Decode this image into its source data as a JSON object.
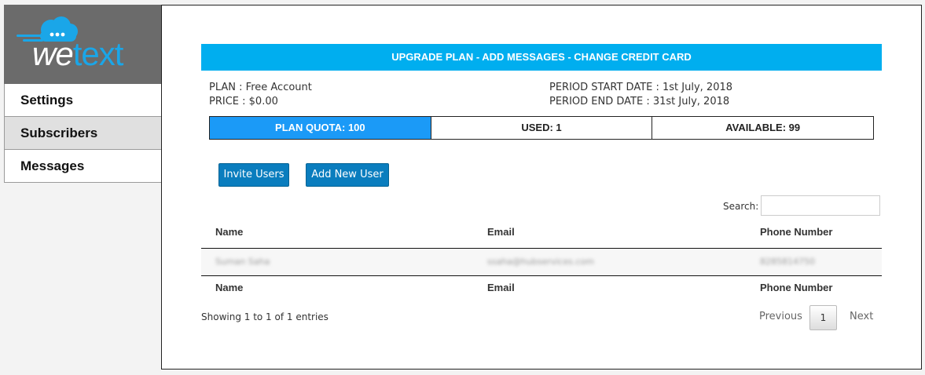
{
  "logo": {
    "text": "wetext"
  },
  "sidebar": {
    "items": [
      {
        "label": "Settings"
      },
      {
        "label": "Subscribers"
      },
      {
        "label": "Messages"
      }
    ]
  },
  "upgrade_bar": {
    "label": "UPGRADE PLAN - ADD MESSAGES - CHANGE CREDIT CARD"
  },
  "plan": {
    "plan_label": "PLAN :",
    "plan_value": "Free Account",
    "price_label": "PRICE :",
    "price_value": "$0.00",
    "start_label": "PERIOD START DATE :",
    "start_value": "1st July, 2018",
    "end_label": "PERIOD END DATE :",
    "end_value": "31st July, 2018"
  },
  "quota": {
    "plan_quota": "PLAN QUOTA: 100",
    "used": "USED: 1",
    "available": "AVAILABLE: 99"
  },
  "buttons": {
    "invite": "Invite Users",
    "add_new": "Add New User"
  },
  "search": {
    "label": "Search:",
    "value": ""
  },
  "table": {
    "columns": [
      "Name",
      "Email",
      "Phone Number"
    ],
    "rows": [
      {
        "name": "Suman Saha",
        "email": "ssaha@hubservices.com",
        "phone": "8285814750"
      }
    ]
  },
  "footer": {
    "info": "Showing 1 to 1 of 1 entries",
    "previous": "Previous",
    "page": "1",
    "next": "Next"
  },
  "colors": {
    "accent": "#00aeef",
    "button": "#0a7dbe",
    "quota_primary": "#1b9af7",
    "logo_bg": "#6b6b6b"
  }
}
